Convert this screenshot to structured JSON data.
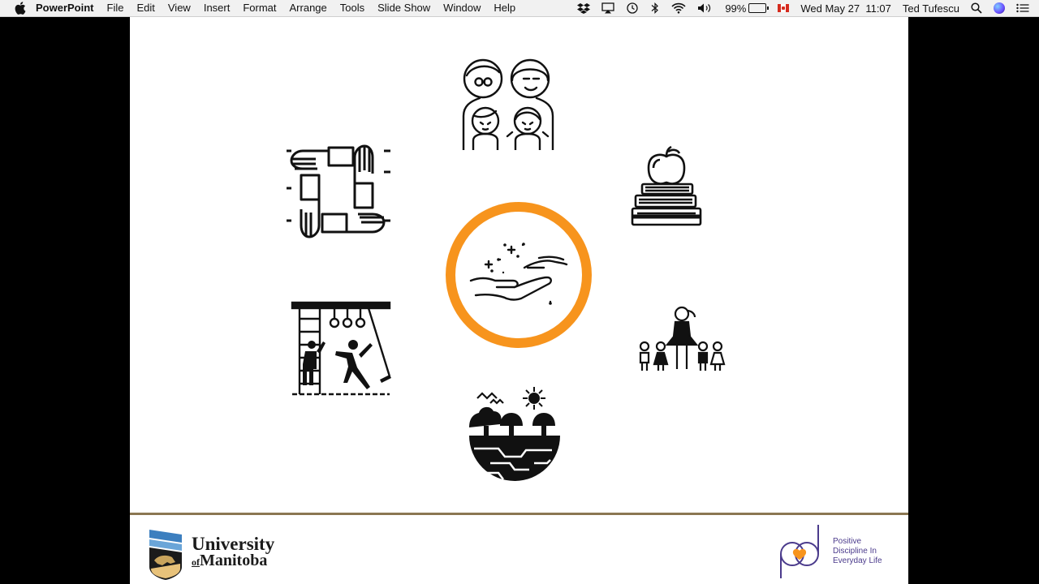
{
  "menubar": {
    "app_name": "PowerPoint",
    "items": [
      "File",
      "Edit",
      "View",
      "Insert",
      "Format",
      "Arrange",
      "Tools",
      "Slide Show",
      "Window",
      "Help"
    ],
    "status": {
      "battery_percent": "99%",
      "datetime": "Wed May 27  11:07",
      "user": "Ted Tufescu"
    }
  },
  "slide": {
    "footer": {
      "uofm_line1": "University",
      "uofm_of": "of",
      "uofm_line2": "Manitoba",
      "pdel_line1": "Positive",
      "pdel_line2": "Discipline In",
      "pdel_line3": "Everyday Life"
    },
    "accent_color": "#f7941d",
    "rule_color": "#8b7752"
  }
}
